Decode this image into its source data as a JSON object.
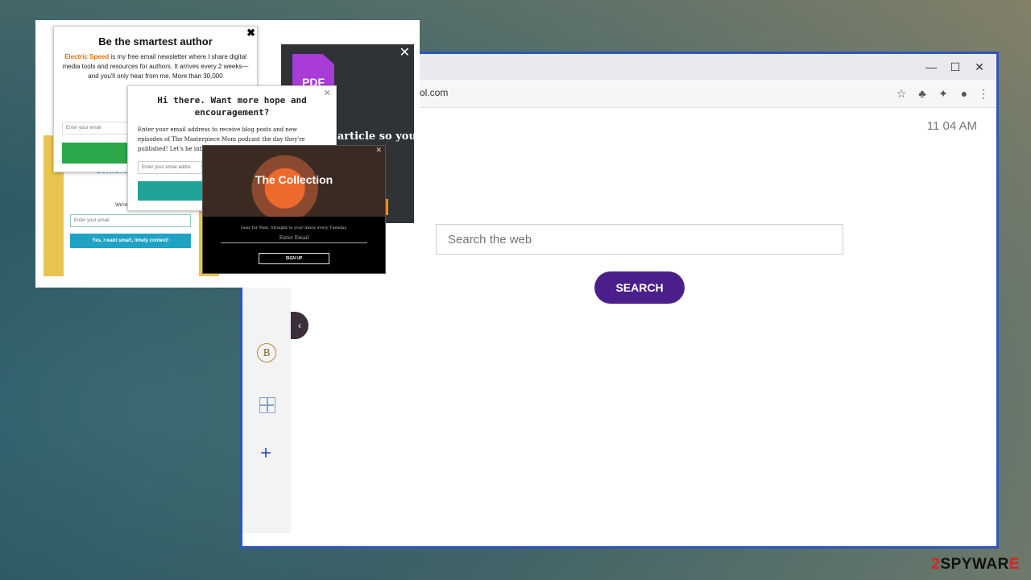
{
  "browser": {
    "url": "ol.com",
    "window_controls": {
      "minimize": "—",
      "maximize": "☐",
      "close": "✕"
    },
    "clock": "11 04 AM",
    "search_placeholder": "Search the web",
    "search_button": "SEARCH",
    "sidebar": {
      "logo": "B",
      "collapse": "‹",
      "add": "+"
    }
  },
  "popups": {
    "author": {
      "title": "Be the smartest author",
      "brand": "Electric Speed",
      "body": " is my free email newsletter where I share digital media tools and resources for authors. It arrives every 2 weeks—and you'll only hear from me. More than 30,000",
      "email_placeholder": "Enter your email",
      "close": "✖"
    },
    "pdf": {
      "icon_label": "PDF",
      "close": "✕",
      "text": "s article so you t later"
    },
    "hope": {
      "title": "Hi there. Want more hope and encouragement?",
      "body": "Enter your email address to receive blog posts and new episodes of The Masterpiece Mom podcast the day they're published! Let's be inbox friends, shall we?",
      "email_placeholder": "Enter your email addre",
      "close": "✕"
    },
    "content": {
      "headline": "content mark out",
      "small": "We're based ba",
      "email_placeholder": "Enter your email",
      "button": "Yes, I want smart, timely content!"
    },
    "collection": {
      "title": "The Collection",
      "tagline": "Gear for Men. Straight to your inbox every Tuesday.",
      "email_placeholder": "Enter Email",
      "button": "SIGN UP",
      "close": "✕"
    }
  },
  "watermark": {
    "prefix": "2",
    "name": "SPYWAR",
    "suffix": "E"
  },
  "colors": {
    "window_border": "#2f56b8",
    "search_button": "#4a1f8c",
    "author_button": "#2ba84a",
    "content_button": "#1fa3c4",
    "pdf_icon": "#a93bd6"
  }
}
